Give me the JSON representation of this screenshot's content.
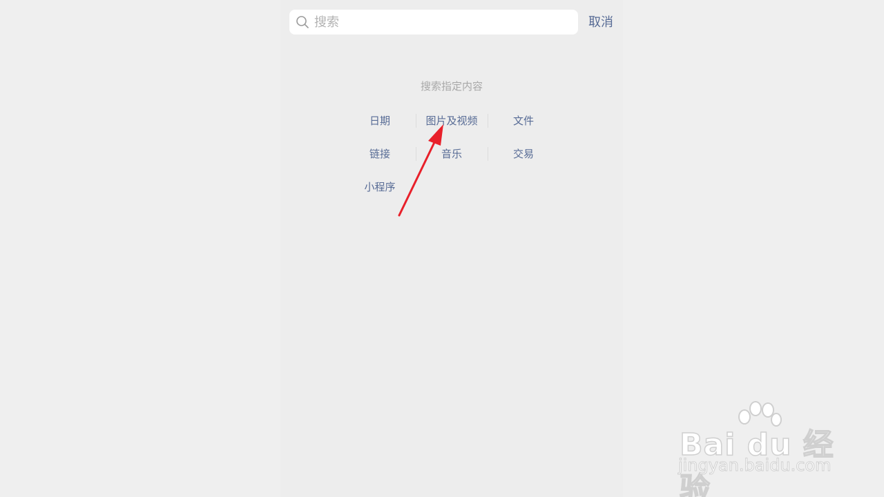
{
  "search": {
    "placeholder": "搜索",
    "value": "",
    "cancel_label": "取消"
  },
  "specified": {
    "title": "搜索指定内容",
    "categories": [
      {
        "label": "日期"
      },
      {
        "label": "图片及视频"
      },
      {
        "label": "文件"
      },
      {
        "label": "链接"
      },
      {
        "label": "音乐"
      },
      {
        "label": "交易"
      },
      {
        "label": "小程序"
      }
    ]
  },
  "colors": {
    "link": "#576b95",
    "annotation_arrow": "#e8202a"
  },
  "watermark": {
    "logo_text": "Bai du 经验",
    "url": "jingyan.baidu.com",
    "icon": "paw-icon"
  }
}
